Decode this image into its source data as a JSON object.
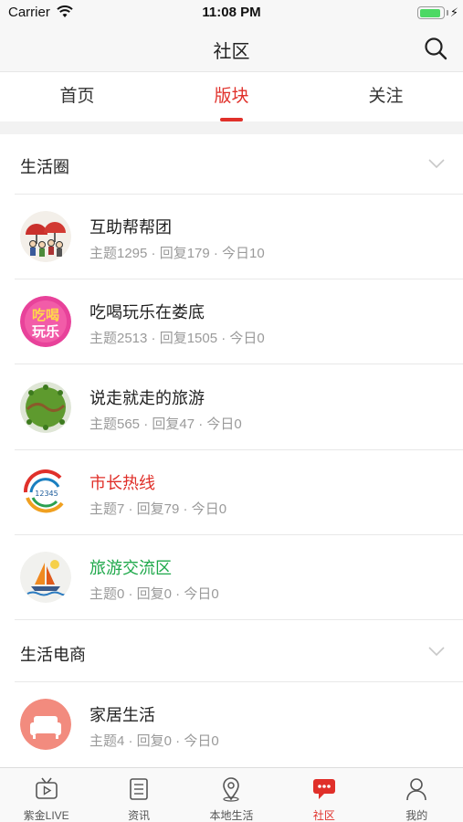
{
  "status": {
    "carrier": "Carrier",
    "time": "11:08 PM",
    "battery_level": 0.95
  },
  "nav": {
    "title": "社区",
    "search_icon": "search-icon"
  },
  "tabs": [
    {
      "label": "首页",
      "active": false
    },
    {
      "label": "版块",
      "active": true
    },
    {
      "label": "关注",
      "active": false
    }
  ],
  "sections": [
    {
      "title": "生活圈",
      "items": [
        {
          "title": "互助帮帮团",
          "stats": "主题1295 · 回复179 · 今日10",
          "title_color": "#222222",
          "icon": "umbrella-people-icon"
        },
        {
          "title": "吃喝玩乐在娄底",
          "stats": "主题2513 · 回复1505 · 今日0",
          "title_color": "#222222",
          "icon": "food-fun-icon"
        },
        {
          "title": "说走就走的旅游",
          "stats": "主题565 · 回复47 · 今日0",
          "title_color": "#222222",
          "icon": "globe-travel-icon"
        },
        {
          "title": "市长热线",
          "stats": "主题7 · 回复79 · 今日0",
          "title_color": "#e0302a",
          "icon": "hotline-12345-icon"
        },
        {
          "title": "旅游交流区",
          "stats": "主题0 · 回复0 · 今日0",
          "title_color": "#1ea84a",
          "icon": "sailboat-icon"
        }
      ]
    },
    {
      "title": "生活电商",
      "items": [
        {
          "title": "家居生活",
          "stats": "主题4 · 回复0 · 今日0",
          "title_color": "#222222",
          "icon": "sofa-icon"
        }
      ]
    }
  ],
  "hotline_badge": "12345",
  "food_badge": {
    "line1": "吃喝",
    "line2": "玩乐"
  },
  "bottom_nav": [
    {
      "label": "紫金LIVE",
      "icon": "tv-play-icon",
      "active": false
    },
    {
      "label": "资讯",
      "icon": "news-list-icon",
      "active": false
    },
    {
      "label": "本地生活",
      "icon": "location-pin-icon",
      "active": false
    },
    {
      "label": "社区",
      "icon": "chat-bubble-icon",
      "active": true
    },
    {
      "label": "我的",
      "icon": "user-icon",
      "active": false
    }
  ],
  "colors": {
    "accent": "#e0302a",
    "green": "#1ea84a",
    "muted": "#9a9a9a"
  }
}
